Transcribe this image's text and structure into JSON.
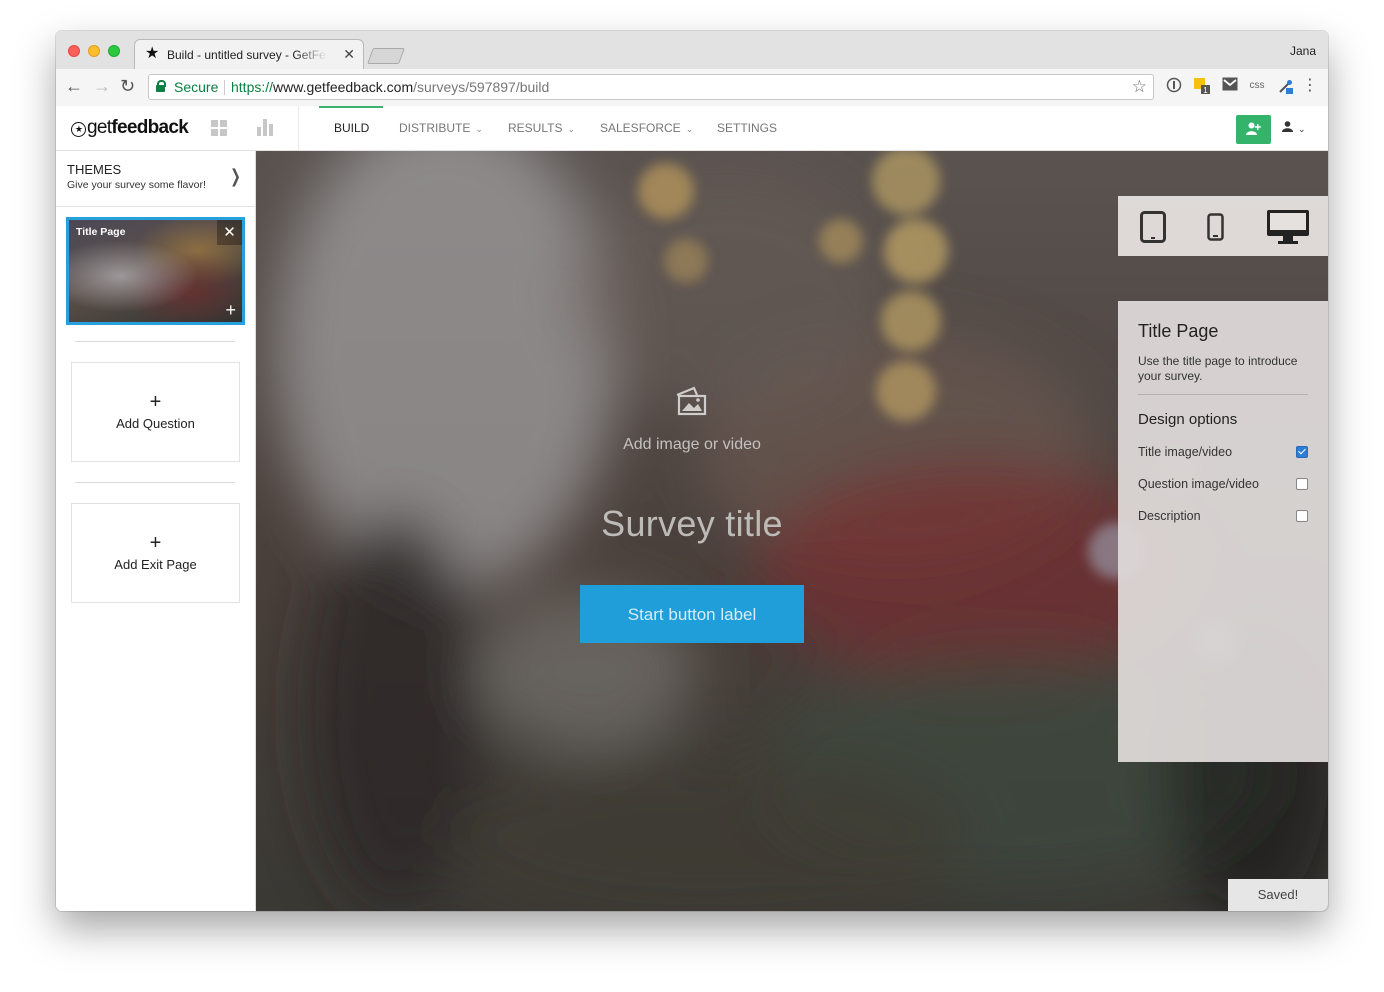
{
  "browser": {
    "tab_title": "Build - untitled survey - GetFeedback",
    "profile_name": "Jana",
    "secure_label": "Secure",
    "url_scheme": "https://",
    "url_host": "www.getfeedback.com",
    "url_path": "/surveys/597897/build",
    "extensions": [
      "1password-icon",
      "keep-icon",
      "gmail-icon",
      "css-icon",
      "eyedropper-icon",
      "more-icon"
    ],
    "extension_badge": "1",
    "extension_css_label": "css"
  },
  "app": {
    "logo_prefix": "get",
    "logo_bold": "feedback",
    "nav": [
      {
        "label": "BUILD",
        "active": true,
        "dropdown": false
      },
      {
        "label": "DISTRIBUTE",
        "active": false,
        "dropdown": true
      },
      {
        "label": "RESULTS",
        "active": false,
        "dropdown": true
      },
      {
        "label": "SALESFORCE",
        "active": false,
        "dropdown": true
      },
      {
        "label": "SETTINGS",
        "active": false,
        "dropdown": false
      }
    ],
    "accent_color": "#34b36a"
  },
  "sidebar": {
    "themes_title": "THEMES",
    "themes_subtitle": "Give your survey some flavor!",
    "page_thumb_label": "Title Page",
    "add_question_label": "Add Question",
    "add_exit_page_label": "Add Exit Page"
  },
  "canvas": {
    "media_prompt": "Add image or video",
    "survey_title": "Survey title",
    "start_button_label": "Start button label",
    "button_color": "#1f9ed9"
  },
  "devices": [
    "tablet-icon",
    "phone-icon",
    "desktop-icon"
  ],
  "panel": {
    "title": "Title Page",
    "description": "Use the title page to introduce your survey.",
    "section_title": "Design options",
    "options": [
      {
        "label": "Title image/video",
        "checked": true
      },
      {
        "label": "Question image/video",
        "checked": false
      },
      {
        "label": "Description",
        "checked": false
      }
    ]
  },
  "status": {
    "saved_label": "Saved!"
  }
}
